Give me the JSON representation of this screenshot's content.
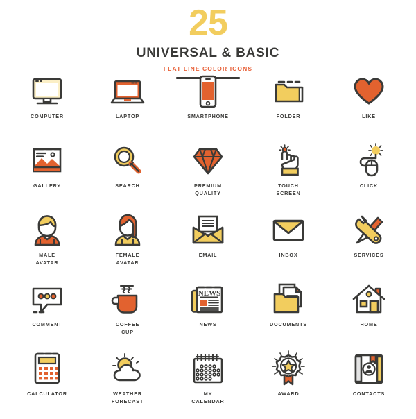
{
  "header": {
    "count": "25",
    "title": "UNIVERSAL & BASIC",
    "subtitle": "FLAT LINE COLOR ICONS"
  },
  "colors": {
    "yellow": "#F2CD5E",
    "yellow_light": "#FBEFC6",
    "orange": "#E2622F",
    "orange_bright": "#E8623A",
    "dark": "#3A3A38",
    "white": "#FFFFFF",
    "gray_light": "#E3E3E3"
  },
  "icons": [
    {
      "id": "computer",
      "name": "computer-icon",
      "label": "COMPUTER"
    },
    {
      "id": "laptop",
      "name": "laptop-icon",
      "label": "LAPTOP"
    },
    {
      "id": "smartphone",
      "name": "smartphone-icon",
      "label": "SMARTPHONE"
    },
    {
      "id": "folder",
      "name": "folder-icon",
      "label": "FOLDER"
    },
    {
      "id": "like",
      "name": "heart-icon",
      "label": "LIKE"
    },
    {
      "id": "gallery",
      "name": "gallery-icon",
      "label": "GALLERY"
    },
    {
      "id": "search",
      "name": "search-icon",
      "label": "SEARCH"
    },
    {
      "id": "premium",
      "name": "diamond-icon",
      "label": "PREMIUM\nQUALITY"
    },
    {
      "id": "touchscreen",
      "name": "touch-hand-icon",
      "label": "TOUCH\nSCREEN"
    },
    {
      "id": "click",
      "name": "mouse-click-icon",
      "label": "CLICK"
    },
    {
      "id": "male",
      "name": "male-avatar-icon",
      "label": "MALE\nAVATAR"
    },
    {
      "id": "female",
      "name": "female-avatar-icon",
      "label": "FEMALE\nAVATAR"
    },
    {
      "id": "email",
      "name": "open-envelope-icon",
      "label": "EMAIL"
    },
    {
      "id": "inbox",
      "name": "envelope-icon",
      "label": "INBOX"
    },
    {
      "id": "services",
      "name": "wrench-screwdriver-icon",
      "label": "SERVICES"
    },
    {
      "id": "comment",
      "name": "speech-bubble-icon",
      "label": "COMMENT"
    },
    {
      "id": "coffee",
      "name": "coffee-cup-icon",
      "label": "COFFEE\nCUP"
    },
    {
      "id": "news",
      "name": "newspaper-icon",
      "label": "NEWS"
    },
    {
      "id": "documents",
      "name": "documents-folder-icon",
      "label": "DOCUMENTS"
    },
    {
      "id": "home",
      "name": "house-icon",
      "label": "HOME"
    },
    {
      "id": "calculator",
      "name": "calculator-icon",
      "label": "CALCULATOR"
    },
    {
      "id": "weather",
      "name": "sun-cloud-icon",
      "label": "WEATHER\nFORECAST"
    },
    {
      "id": "calendar",
      "name": "calendar-icon",
      "label": "MY\nCALENDAR"
    },
    {
      "id": "award",
      "name": "award-medal-icon",
      "label": "AWARD"
    },
    {
      "id": "contacts",
      "name": "contacts-book-icon",
      "label": "CONTACTS"
    }
  ],
  "news_icon_text": "NEWS"
}
